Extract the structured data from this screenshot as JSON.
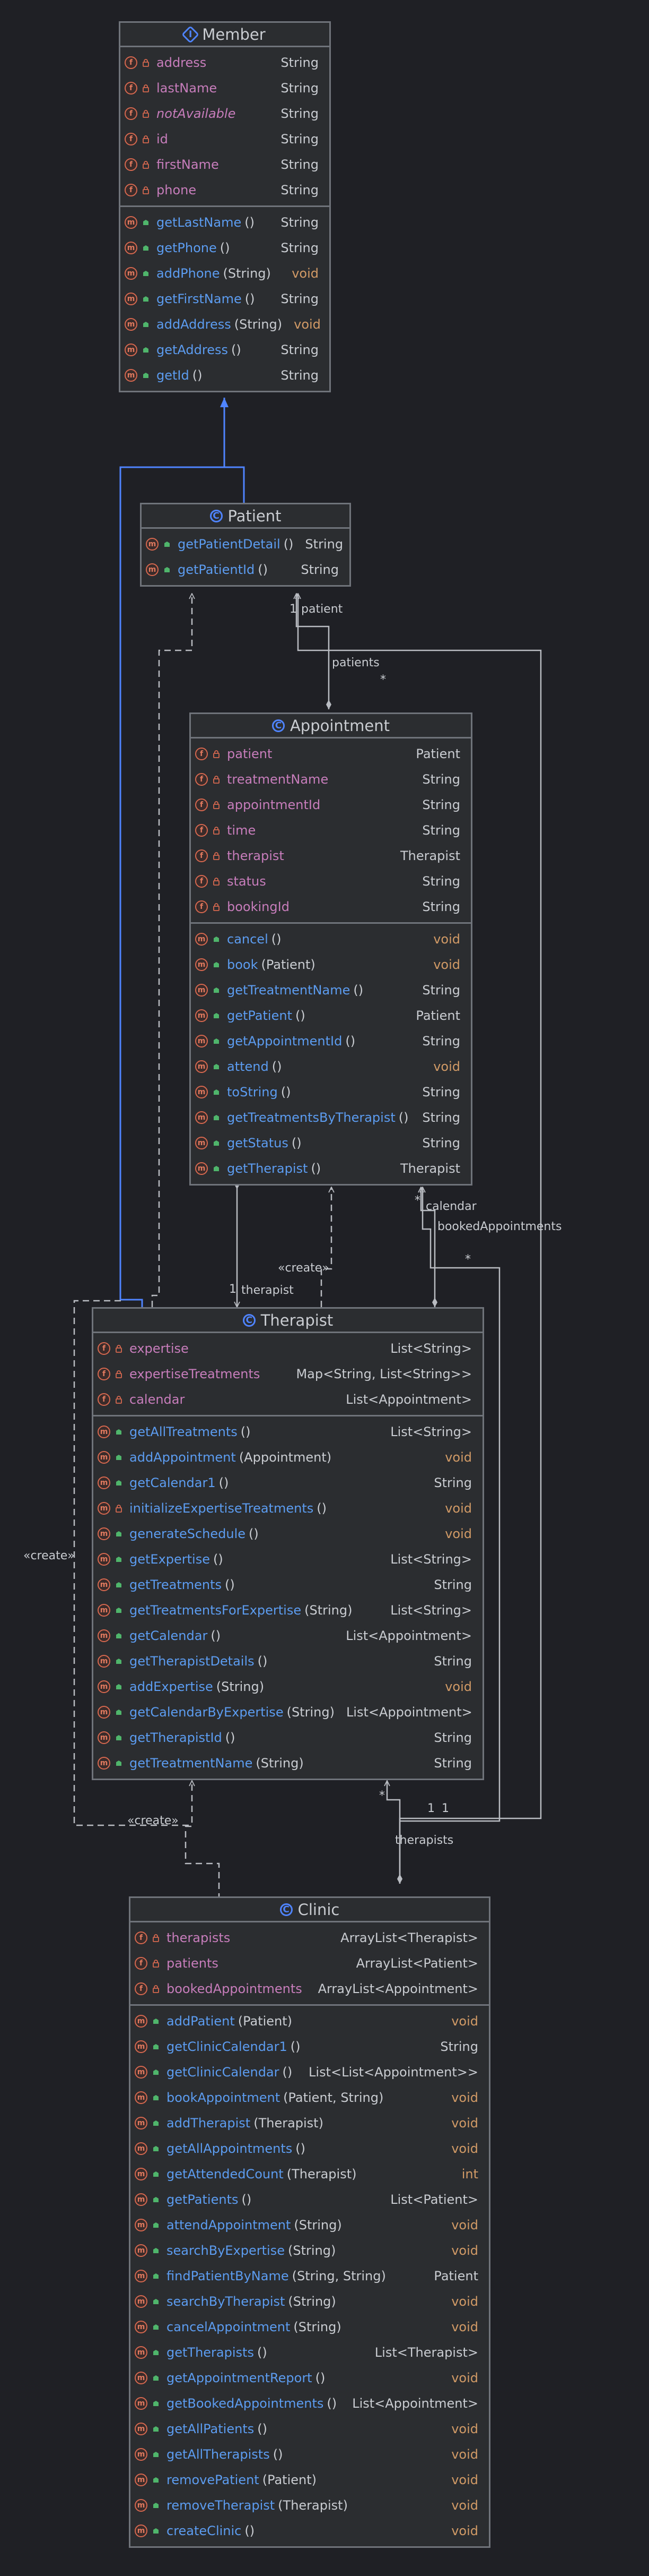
{
  "classes": {
    "member": {
      "name": "Member",
      "kind": "interface",
      "fields": [
        {
          "name": "address",
          "type": "String"
        },
        {
          "name": "lastName",
          "type": "String"
        },
        {
          "name": "notAvailable",
          "type": "String",
          "static": true
        },
        {
          "name": "id",
          "type": "String"
        },
        {
          "name": "firstName",
          "type": "String"
        },
        {
          "name": "phone",
          "type": "String"
        }
      ],
      "methods": [
        {
          "name": "getLastName",
          "params": "()",
          "type": "String"
        },
        {
          "name": "getPhone",
          "params": "()",
          "type": "String"
        },
        {
          "name": "addPhone",
          "params": "(String)",
          "type": "void"
        },
        {
          "name": "getFirstName",
          "params": "()",
          "type": "String"
        },
        {
          "name": "addAddress",
          "params": "(String)",
          "type": "void"
        },
        {
          "name": "getAddress",
          "params": "()",
          "type": "String"
        },
        {
          "name": "getId",
          "params": "()",
          "type": "String"
        }
      ]
    },
    "patient": {
      "name": "Patient",
      "kind": "class",
      "fields": [],
      "methods": [
        {
          "name": "getPatientDetail",
          "params": "()",
          "type": "String"
        },
        {
          "name": "getPatientId",
          "params": "()",
          "type": "String"
        }
      ]
    },
    "appointment": {
      "name": "Appointment",
      "kind": "class",
      "fields": [
        {
          "name": "patient",
          "type": "Patient"
        },
        {
          "name": "treatmentName",
          "type": "String"
        },
        {
          "name": "appointmentId",
          "type": "String"
        },
        {
          "name": "time",
          "type": "String"
        },
        {
          "name": "therapist",
          "type": "Therapist"
        },
        {
          "name": "status",
          "type": "String"
        },
        {
          "name": "bookingId",
          "type": "String"
        }
      ],
      "methods": [
        {
          "name": "cancel",
          "params": "()",
          "type": "void"
        },
        {
          "name": "book",
          "params": "(Patient)",
          "type": "void"
        },
        {
          "name": "getTreatmentName",
          "params": "()",
          "type": "String"
        },
        {
          "name": "getPatient",
          "params": "()",
          "type": "Patient"
        },
        {
          "name": "getAppointmentId",
          "params": "()",
          "type": "String"
        },
        {
          "name": "attend",
          "params": "()",
          "type": "void"
        },
        {
          "name": "toString",
          "params": "()",
          "type": "String"
        },
        {
          "name": "getTreatmentsByTherapist",
          "params": "()",
          "type": "String"
        },
        {
          "name": "getStatus",
          "params": "()",
          "type": "String"
        },
        {
          "name": "getTherapist",
          "params": "()",
          "type": "Therapist"
        }
      ]
    },
    "therapist": {
      "name": "Therapist",
      "kind": "class",
      "fields": [
        {
          "name": "expertise",
          "type": "List<String>"
        },
        {
          "name": "expertiseTreatments",
          "type": "Map<String, List<String>>"
        },
        {
          "name": "calendar",
          "type": "List<Appointment>"
        }
      ],
      "methods": [
        {
          "name": "getAllTreatments",
          "params": "()",
          "type": "List<String>"
        },
        {
          "name": "addAppointment",
          "params": "(Appointment)",
          "type": "void"
        },
        {
          "name": "getCalendar1",
          "params": "()",
          "type": "String"
        },
        {
          "name": "initializeExpertiseTreatments",
          "params": "()",
          "type": "void",
          "private": true
        },
        {
          "name": "generateSchedule",
          "params": "()",
          "type": "void"
        },
        {
          "name": "getExpertise",
          "params": "()",
          "type": "List<String>"
        },
        {
          "name": "getTreatments",
          "params": "()",
          "type": "String"
        },
        {
          "name": "getTreatmentsForExpertise",
          "params": "(String)",
          "type": "List<String>"
        },
        {
          "name": "getCalendar",
          "params": "()",
          "type": "List<Appointment>"
        },
        {
          "name": "getTherapistDetails",
          "params": "()",
          "type": "String"
        },
        {
          "name": "addExpertise",
          "params": "(String)",
          "type": "void"
        },
        {
          "name": "getCalendarByExpertise",
          "params": "(String)",
          "type": "List<Appointment>"
        },
        {
          "name": "getTherapistId",
          "params": "()",
          "type": "String"
        },
        {
          "name": "getTreatmentName",
          "params": "(String)",
          "type": "String"
        }
      ]
    },
    "clinic": {
      "name": "Clinic",
      "kind": "class",
      "fields": [
        {
          "name": "therapists",
          "type": "ArrayList<Therapist>"
        },
        {
          "name": "patients",
          "type": "ArrayList<Patient>"
        },
        {
          "name": "bookedAppointments",
          "type": "ArrayList<Appointment>"
        }
      ],
      "methods": [
        {
          "name": "addPatient",
          "params": "(Patient)",
          "type": "void"
        },
        {
          "name": "getClinicCalendar1",
          "params": "()",
          "type": "String"
        },
        {
          "name": "getClinicCalendar",
          "params": "()",
          "type": "List<List<Appointment>>"
        },
        {
          "name": "bookAppointment",
          "params": "(Patient, String)",
          "type": "void"
        },
        {
          "name": "addTherapist",
          "params": "(Therapist)",
          "type": "void"
        },
        {
          "name": "getAllAppointments",
          "params": "()",
          "type": "void"
        },
        {
          "name": "getAttendedCount",
          "params": "(Therapist)",
          "type": "int"
        },
        {
          "name": "getPatients",
          "params": "()",
          "type": "List<Patient>"
        },
        {
          "name": "attendAppointment",
          "params": "(String)",
          "type": "void"
        },
        {
          "name": "searchByExpertise",
          "params": "(String)",
          "type": "void"
        },
        {
          "name": "findPatientByName",
          "params": "(String, String)",
          "type": "Patient"
        },
        {
          "name": "searchByTherapist",
          "params": "(String)",
          "type": "void"
        },
        {
          "name": "cancelAppointment",
          "params": "(String)",
          "type": "void"
        },
        {
          "name": "getTherapists",
          "params": "()",
          "type": "List<Therapist>"
        },
        {
          "name": "getAppointmentReport",
          "params": "()",
          "type": "void"
        },
        {
          "name": "getBookedAppointments",
          "params": "()",
          "type": "List<Appointment>"
        },
        {
          "name": "getAllPatients",
          "params": "()",
          "type": "void"
        },
        {
          "name": "getAllTherapists",
          "params": "()",
          "type": "void"
        },
        {
          "name": "removePatient",
          "params": "(Patient)",
          "type": "void"
        },
        {
          "name": "removeTherapist",
          "params": "(Therapist)",
          "type": "void"
        },
        {
          "name": "createClinic",
          "params": "()",
          "type": "void"
        }
      ]
    }
  },
  "labels": {
    "patient_role": "patient",
    "patient_mult": "1",
    "patients_role": "patients",
    "patients_mult": "*",
    "therapist_role": "therapist",
    "therapist_mult": "1",
    "create_1": "«create»",
    "create_2": "«create»",
    "create_3": "«create»",
    "calendar_role": "calendar",
    "calendar_mult": "*",
    "booked_role": "bookedAppointments",
    "booked_mult": "*",
    "mult_1a": "1",
    "mult_1b": "1",
    "therapists_role": "therapists",
    "therapists_mult": "*"
  },
  "colors": {
    "background": "#1f2025",
    "box": "#2b2d30",
    "border": "#6f737a",
    "field_name": "#c77dbb",
    "method_name": "#5c9cf0",
    "primitive_type": "#d19a66",
    "icon_red": "#e07a5f",
    "class_icon_blue": "#4f84ff",
    "edge": "#b9bcc2",
    "inheritance": "#4f84ff"
  }
}
